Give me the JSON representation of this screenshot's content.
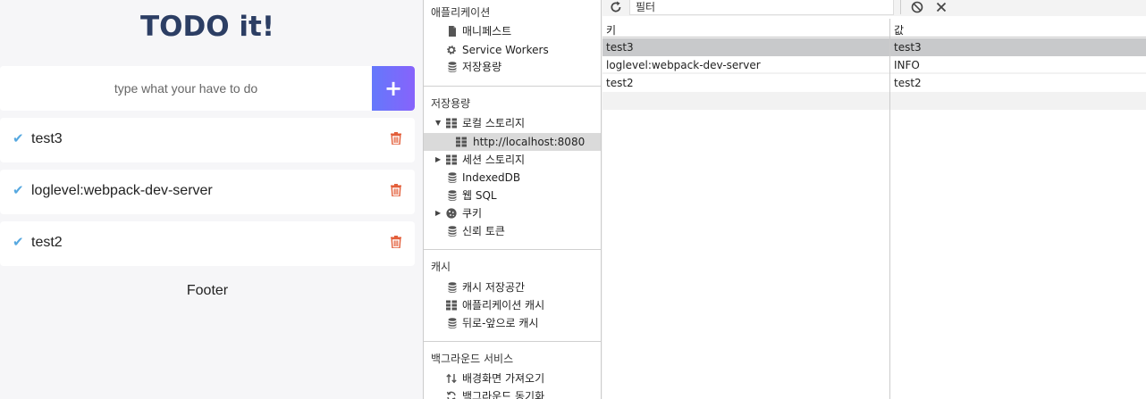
{
  "todo": {
    "title": "TODO it!",
    "input_placeholder": "type what your have to do",
    "add_label": "+",
    "items": [
      {
        "text": "test3"
      },
      {
        "text": "loglevel:webpack-dev-server"
      },
      {
        "text": "test2"
      }
    ],
    "footer": "Footer",
    "colors": {
      "check": "#56a8e0",
      "trash": "#e35f3b",
      "title": "#2c3e64",
      "button_start": "#6478fb",
      "button_end": "#8763fb"
    }
  },
  "devtools": {
    "sidebar": {
      "application": {
        "header": "애플리케이션",
        "items": [
          {
            "label": "매니페스트",
            "icon": "file-icon"
          },
          {
            "label": "Service Workers",
            "icon": "gear-icon"
          },
          {
            "label": "저장용량",
            "icon": "database-icon"
          }
        ]
      },
      "storage": {
        "header": "저장용량",
        "items": [
          {
            "label": "로컬 스토리지",
            "icon": "grid-icon",
            "expanded": true
          },
          {
            "label": "http://localhost:8080",
            "icon": "grid-icon",
            "selected": true
          },
          {
            "label": "세션 스토리지",
            "icon": "grid-icon",
            "expanded": false
          },
          {
            "label": "IndexedDB",
            "icon": "database-icon"
          },
          {
            "label": "웹 SQL",
            "icon": "database-icon"
          },
          {
            "label": "쿠키",
            "icon": "cookie-icon",
            "expanded": false
          },
          {
            "label": "신뢰 토큰",
            "icon": "database-icon"
          }
        ]
      },
      "cache": {
        "header": "캐시",
        "items": [
          {
            "label": "캐시 저장공간",
            "icon": "database-icon"
          },
          {
            "label": "애플리케이션 캐시",
            "icon": "grid-icon"
          },
          {
            "label": "뒤로-앞으로 캐시",
            "icon": "database-icon"
          }
        ]
      },
      "background": {
        "header": "백그라운드 서비스",
        "items": [
          {
            "label": "배경화면 가져오기",
            "icon": "fetch-arrows-icon"
          },
          {
            "label": "백그라운드 동기화",
            "icon": "sync-icon"
          }
        ]
      }
    },
    "storage_table": {
      "filter_placeholder": "필터",
      "columns": [
        "키",
        "값"
      ],
      "rows": [
        {
          "key": "test3",
          "value": "test3",
          "selected": true
        },
        {
          "key": "loglevel:webpack-dev-server",
          "value": "INFO"
        },
        {
          "key": "test2",
          "value": "test2"
        }
      ]
    }
  }
}
